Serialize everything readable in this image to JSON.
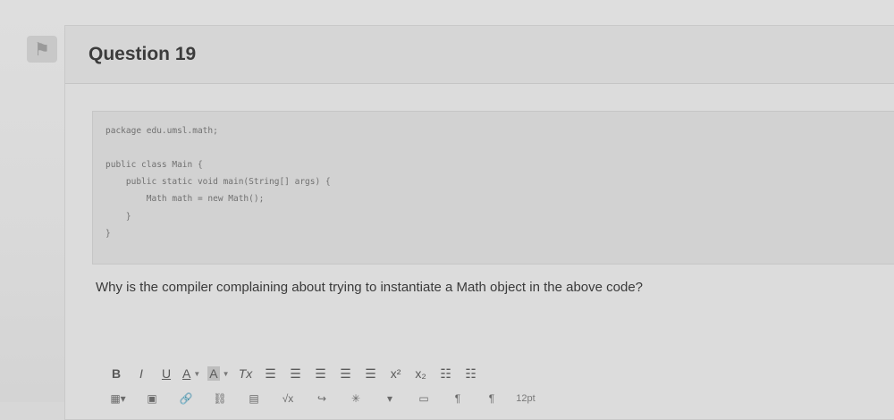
{
  "question": {
    "title": "Question 19",
    "code_lines": [
      "package edu.umsl.math;",
      "",
      "public class Main {",
      "    public static void main(String[] args) {",
      "        Math math = new Math();",
      "    }",
      "}"
    ],
    "prompt": "Why is the compiler complaining about trying to instantiate a Math object in the above code?"
  },
  "toolbar": {
    "bold": "B",
    "italic": "I",
    "underline": "U",
    "font_color": "A",
    "bg_color": "A",
    "clear_format": "Tx",
    "superscript": "x²",
    "subscript": "x₂",
    "font_size": "12pt"
  },
  "colors": {
    "background": "#d7d7d7",
    "title_text": "#3c3c3c",
    "code_text": "#707070"
  }
}
